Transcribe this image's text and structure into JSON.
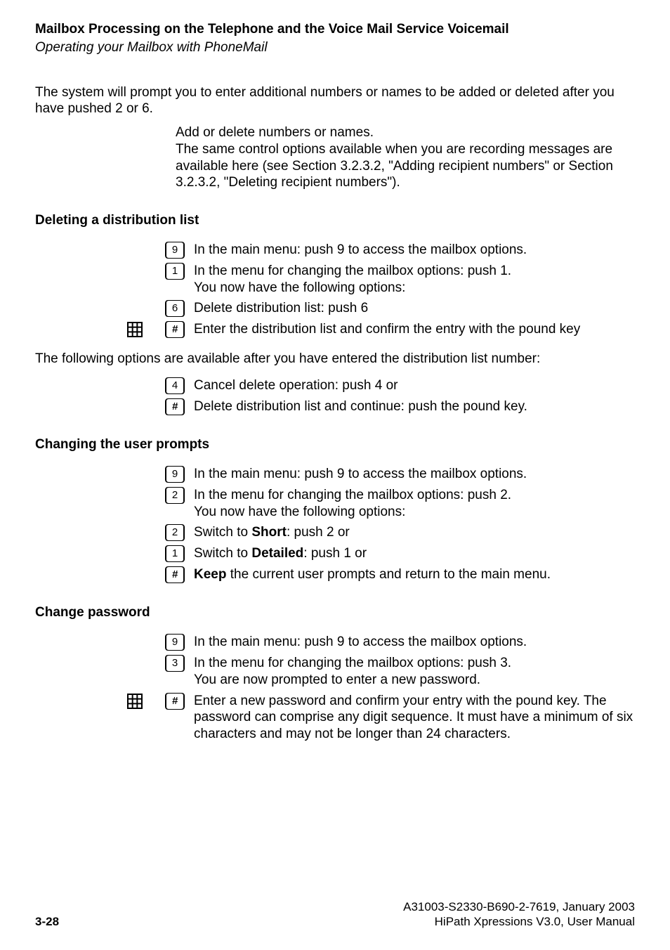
{
  "header": {
    "title": "Mailbox Processing on the Telephone and the Voice Mail Service Voicemail",
    "subtitle": "Operating your Mailbox with PhoneMail"
  },
  "intro": {
    "para": "The system will prompt you to enter additional numbers or names to be added or deleted after you have pushed 2 or 6.",
    "add_delete_line": "Add or delete numbers or names.",
    "options_para": "The same control options available when you are recording messages are available here (see Section 3.2.3.2, \"Adding recipient numbers\" or Section 3.2.3.2, \"Deleting recipient numbers\")."
  },
  "sections": {
    "deleting": {
      "heading": "Deleting a distribution list",
      "rows": [
        {
          "key": "9",
          "text": "In the main menu: push 9 to access the mailbox options."
        },
        {
          "key": "1",
          "text": "In the menu for changing the mailbox options: push 1.\nYou now have the following options:"
        },
        {
          "key": "6",
          "text": "Delete distribution list: push 6"
        },
        {
          "grid": true,
          "key": "#",
          "text": "Enter the distribution list and confirm the entry with the pound key"
        }
      ],
      "after": "The following options are available after you have entered the distribution list number:",
      "rows2": [
        {
          "key": "4",
          "text": "Cancel delete operation: push 4 or"
        },
        {
          "key": "#",
          "text": "Delete distribution list and continue: push the pound key."
        }
      ]
    },
    "changing": {
      "heading": "Changing the user prompts",
      "rows": [
        {
          "key": "9",
          "text": "In the main menu: push 9 to access the mailbox options."
        },
        {
          "key": "2",
          "text": "In the menu for changing the mailbox options: push 2.\nYou now have the following options:"
        },
        {
          "key": "2",
          "prefix": "Switch to ",
          "bold": "Short",
          "suffix": ": push 2 or"
        },
        {
          "key": "1",
          "prefix": "Switch to ",
          "bold": "Detailed",
          "suffix": ": push 1 or"
        },
        {
          "key": "#",
          "bold": "Keep",
          "suffix": " the current user prompts and return to the main menu."
        }
      ]
    },
    "password": {
      "heading": "Change password",
      "rows": [
        {
          "key": "9",
          "text": "In the main menu: push 9 to access the mailbox options."
        },
        {
          "key": "3",
          "text": "In the menu for changing the mailbox options: push 3.\nYou are now prompted to enter a new password."
        },
        {
          "grid": true,
          "key": "#",
          "text": "Enter a new password and confirm your entry with the pound key. The password can comprise any digit sequence. It must have a minimum of six characters and may not be longer than 24 characters."
        }
      ]
    }
  },
  "footer": {
    "page": "3-28",
    "docnum": "A31003-S2330-B690-2-7619, January 2003",
    "docname": "HiPath Xpressions V3.0, User Manual"
  }
}
